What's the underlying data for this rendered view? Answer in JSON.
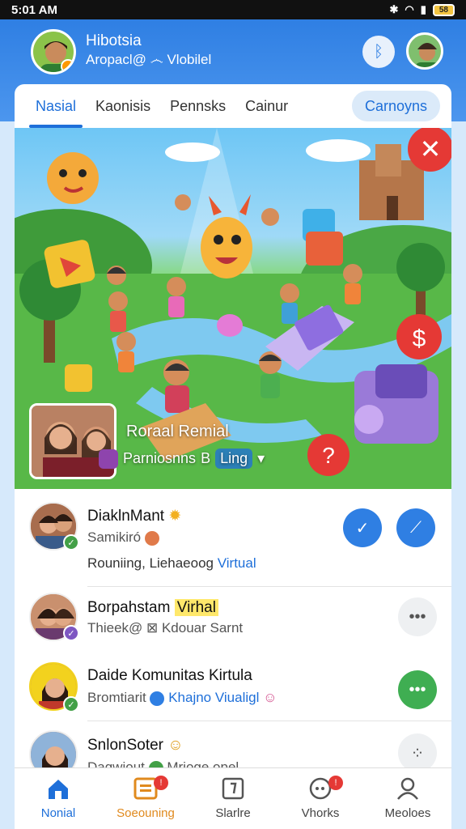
{
  "status_bar": {
    "time": "5:01 AM",
    "battery": "58"
  },
  "header": {
    "title": "Hibotsia",
    "subtitle": "Aropacl@ ෴ Vlobilel"
  },
  "tabs": [
    {
      "label": "Nasial",
      "active": true
    },
    {
      "label": "Kaonisis",
      "active": false
    },
    {
      "label": "Pennsks",
      "active": false
    },
    {
      "label": "Cainur",
      "active": false
    },
    {
      "label": "Carnoyns",
      "active": false
    }
  ],
  "hero": {
    "caption_title": "Roraal Remial",
    "caption_sub": "Parniosnns",
    "caption_badge": "B",
    "caption_pill": "Ling",
    "close_glyph": "✕"
  },
  "list": [
    {
      "title": "DiaklnMant",
      "sub": "Samikiró",
      "line3_a": "Rouniing,",
      "line3_b": "Liehaeoog",
      "line3_c": "Virtual",
      "action": "check"
    },
    {
      "title": "Borpahstam",
      "tag": "Virhal",
      "sub": "Thieek@ ⊠ Kdouar Sarnt",
      "action": "more"
    },
    {
      "title": "Daide Komunitas Kirtula",
      "sub": "Bromtiarit",
      "sub_blue": "Khajno Viualigl",
      "action": "chat"
    },
    {
      "title": "SnlonSoter",
      "sub": "Dagwiout",
      "sub_blue": "Mrioge opel",
      "action": "more"
    }
  ],
  "bottom_nav": [
    {
      "label": "Nonial",
      "icon": "home-icon",
      "active": true
    },
    {
      "label": "Soeouning",
      "icon": "calendar-icon",
      "badge": "!"
    },
    {
      "label": "Slarlre",
      "icon": "note-icon"
    },
    {
      "label": "Vhorks",
      "icon": "chat-bubble-icon",
      "badge": "!"
    },
    {
      "label": "Meoloes",
      "icon": "person-icon"
    }
  ],
  "colors": {
    "primary": "#2f7fe3",
    "accent": "#1e6fd9",
    "danger": "#e53935",
    "success": "#43a047"
  }
}
